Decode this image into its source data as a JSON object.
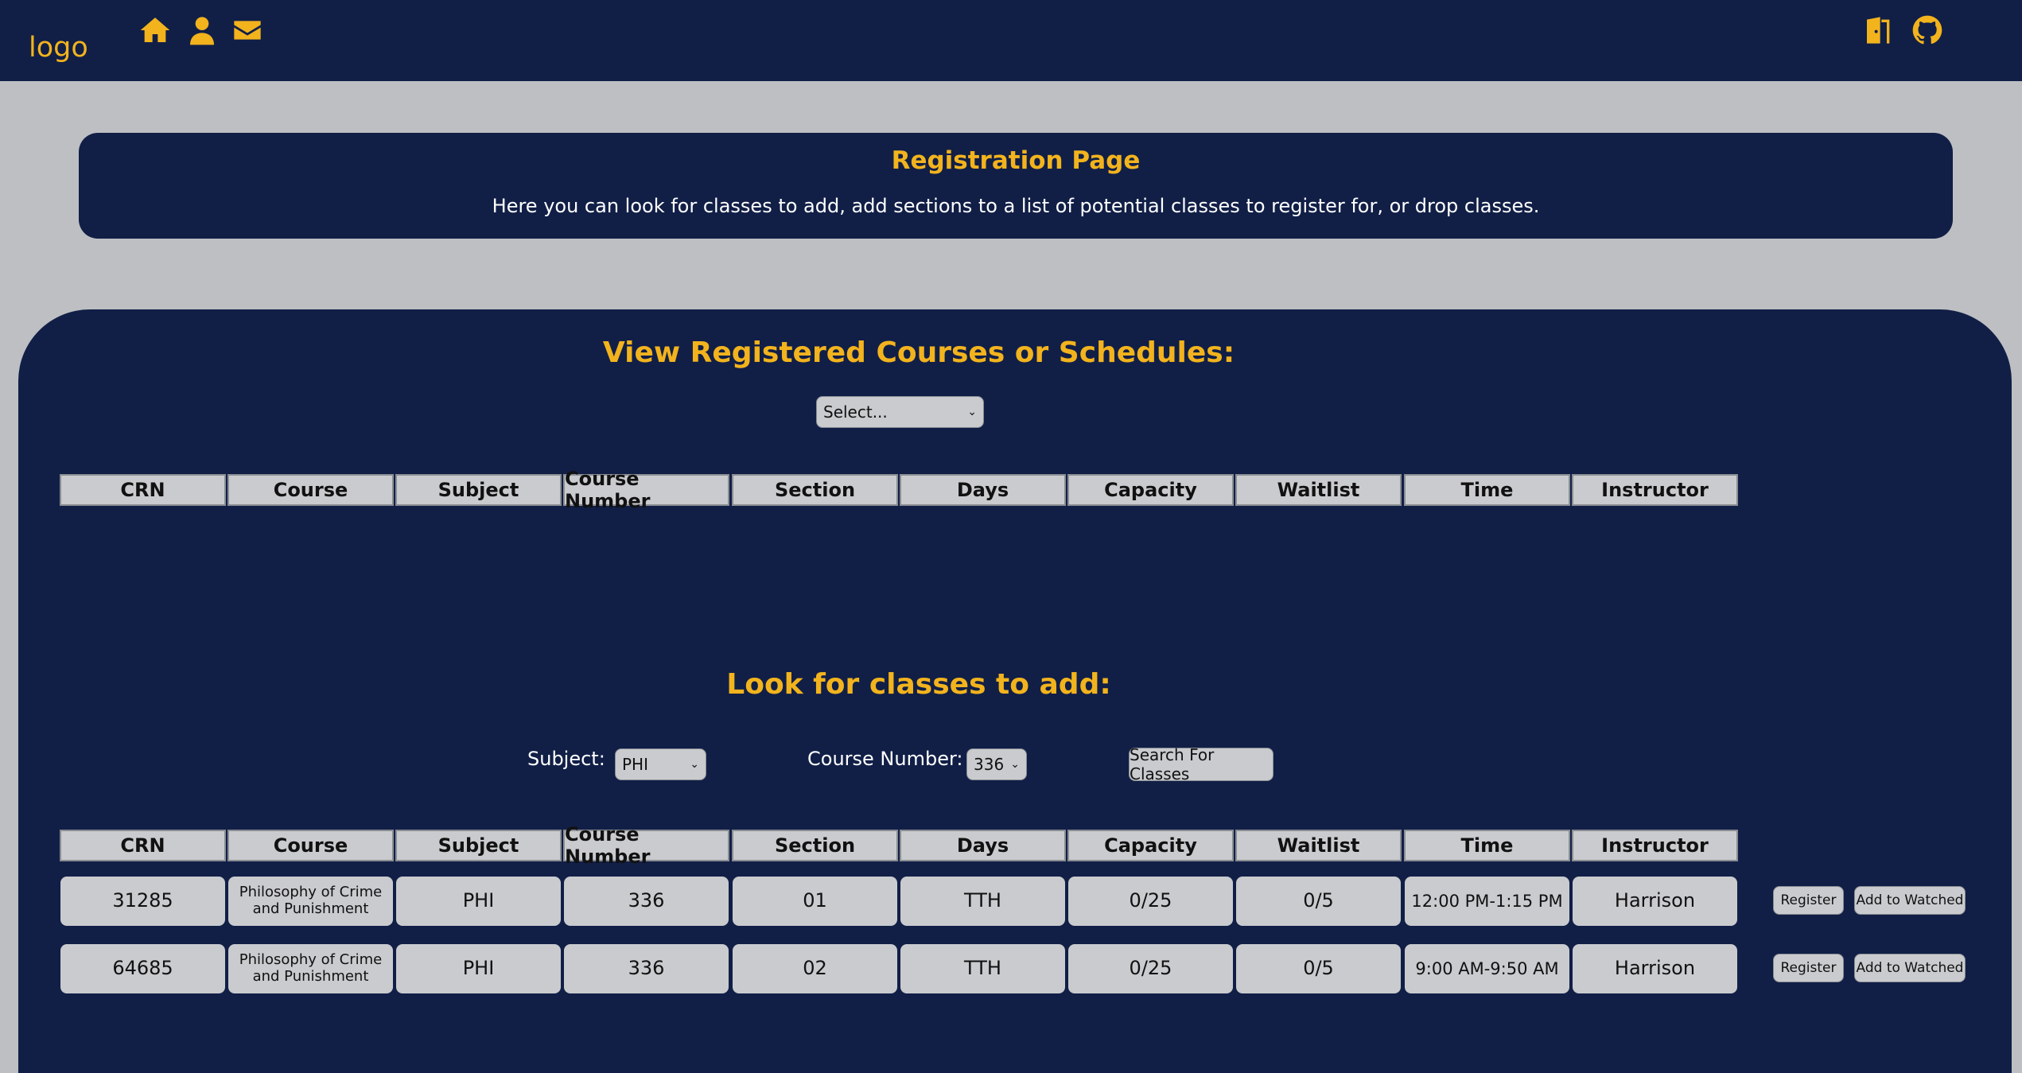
{
  "topbar": {
    "logo": "logo",
    "icons": [
      "home-icon",
      "user-icon",
      "envelope-icon",
      "door-icon",
      "github-icon"
    ],
    "accent_color": "#f2b31d",
    "background_color": "#111f47"
  },
  "banner": {
    "title": "Registration Page",
    "description": "Here you can look for classes to add, add sections to a list of potential classes to register for, or drop classes."
  },
  "registered": {
    "title": "View Registered Courses or Schedules:",
    "select_value": "Select...",
    "headers": [
      "CRN",
      "Course",
      "Subject",
      "Course Number",
      "Section",
      "Days",
      "Capacity",
      "Waitlist",
      "Time",
      "Instructor"
    ]
  },
  "search": {
    "title": "Look for classes to add:",
    "subject_label": "Subject:",
    "subject_value": "PHI",
    "course_number_label": "Course Number:",
    "course_number_value": "336",
    "search_button": "Search For Classes",
    "headers": [
      "CRN",
      "Course",
      "Subject",
      "Course Number",
      "Section",
      "Days",
      "Capacity",
      "Waitlist",
      "Time",
      "Instructor"
    ],
    "rows": [
      {
        "crn": "31285",
        "course": "Philosophy of Crime and Punishment",
        "subject": "PHI",
        "course_number": "336",
        "section": "01",
        "days": "TTH",
        "capacity": "0/25",
        "waitlist": "0/5",
        "time": "12:00 PM-1:15 PM",
        "instructor": "Harrison",
        "register": "Register",
        "watch": "Add to Watched"
      },
      {
        "crn": "64685",
        "course": "Philosophy of Crime and Punishment",
        "subject": "PHI",
        "course_number": "336",
        "section": "02",
        "days": "TTH",
        "capacity": "0/25",
        "waitlist": "0/5",
        "time": "9:00 AM-9:50 AM",
        "instructor": "Harrison",
        "register": "Register",
        "watch": "Add to Watched"
      }
    ]
  }
}
